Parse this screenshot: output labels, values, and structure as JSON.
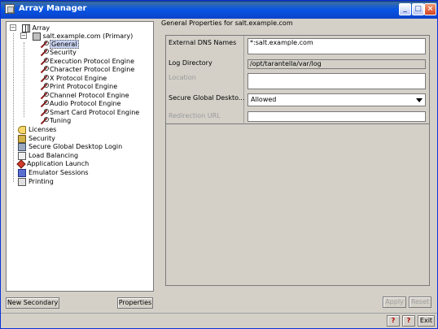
{
  "window": {
    "title": "Array Manager",
    "controls": [
      "_",
      "□",
      "×"
    ]
  },
  "tree": {
    "items": [
      {
        "label": "Array",
        "icon": "array-icon",
        "level": 0,
        "expander": "−"
      },
      {
        "label": "salt.example.com (Primary)",
        "icon": "server-icon",
        "level": 1,
        "expander": "−"
      },
      {
        "label": "General",
        "icon": "wrench-icon",
        "level": 2,
        "selected": true
      },
      {
        "label": "Security",
        "icon": "wrench-icon",
        "level": 2
      },
      {
        "label": "Execution Protocol Engine",
        "icon": "wrench-icon",
        "level": 2
      },
      {
        "label": "Character Protocol Engine",
        "icon": "wrench-icon",
        "level": 2
      },
      {
        "label": "X Protocol Engine",
        "icon": "wrench-icon",
        "level": 2
      },
      {
        "label": "Print Protocol Engine",
        "icon": "wrench-icon",
        "level": 2
      },
      {
        "label": "Channel Protocol Engine",
        "icon": "wrench-icon",
        "level": 2
      },
      {
        "label": "Audio Protocol Engine",
        "icon": "wrench-icon",
        "level": 2
      },
      {
        "label": "Smart Card Protocol Engine",
        "icon": "wrench-icon",
        "level": 2
      },
      {
        "label": "Tuning",
        "icon": "wrench-icon",
        "level": 2
      },
      {
        "label": "Licenses",
        "icon": "key-icon",
        "level": 0
      },
      {
        "label": "Security",
        "icon": "lock-icon",
        "level": 0
      },
      {
        "label": "Secure Global Desktop Login",
        "icon": "login-icon",
        "level": 0
      },
      {
        "label": "Load Balancing",
        "icon": "balance-icon",
        "level": 0
      },
      {
        "label": "Application Launch",
        "icon": "launch-icon",
        "level": 0
      },
      {
        "label": "Emulator Sessions",
        "icon": "emulator-icon",
        "level": 0
      },
      {
        "label": "Printing",
        "icon": "printer-icon",
        "level": 0
      }
    ]
  },
  "left_buttons": {
    "new_secondary": "New Secondary",
    "properties": "Properties"
  },
  "right": {
    "header": "General Properties for salt.example.com",
    "properties": {
      "external_dns": {
        "label": "External DNS Names",
        "value": "*:salt.example.com"
      },
      "log_directory": {
        "label": "Log Directory",
        "value": "/opt/tarantella/var/log"
      },
      "location": {
        "label": "Location",
        "value": ""
      },
      "secure_desktop": {
        "label": "Secure Global Deskto...",
        "value": "Allowed"
      },
      "redirection_url": {
        "label": "Redirection URL",
        "value": ""
      }
    },
    "apply": "Apply",
    "reset": "Reset"
  },
  "footer": {
    "help": "?",
    "context_help": "?",
    "exit": "Exit"
  }
}
